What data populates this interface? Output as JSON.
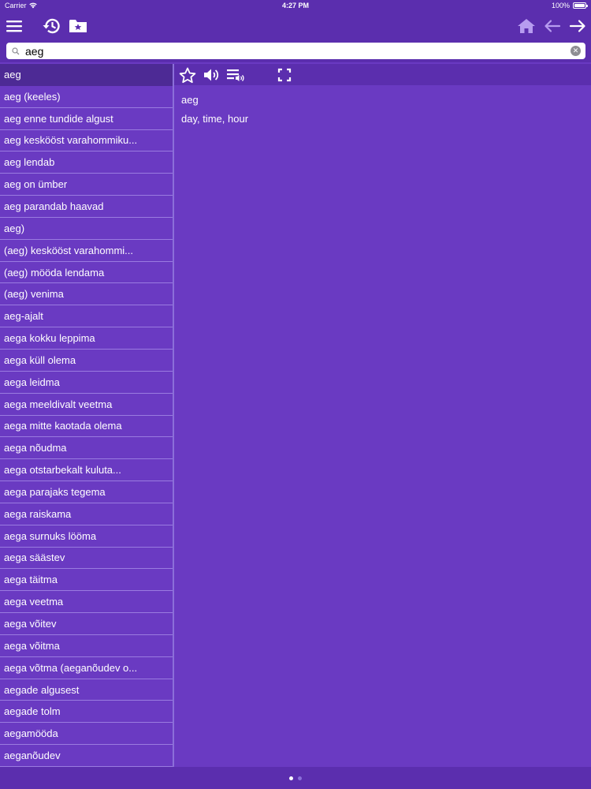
{
  "status": {
    "carrier": "Carrier",
    "time": "4:27 PM",
    "battery": "100%"
  },
  "toolbar": {
    "icons": [
      "menu-icon",
      "history-icon",
      "favorites-folder-icon",
      "home-icon",
      "back-arrow-icon",
      "forward-arrow-icon"
    ]
  },
  "search": {
    "value": "aeg",
    "placeholder": ""
  },
  "word_list": [
    "aeg",
    "aeg (keeles)",
    "aeg enne tundide algust",
    "aeg keskööst varahommiku...",
    "aeg lendab",
    "aeg on ümber",
    "aeg parandab haavad",
    "aeg)",
    "(aeg) keskööst varahommi...",
    "(aeg) mööda lendama",
    "(aeg) venima",
    "aeg-ajalt",
    "aega kokku leppima",
    "aega küll olema",
    "aega leidma",
    "aega meeldivalt veetma",
    "aega mitte kaotada olema",
    "aega nõudma",
    "aega otstarbekalt kuluta...",
    "aega parajaks tegema",
    "aega raiskama",
    "aega surnuks lööma",
    "aega säästev",
    "aega täitma",
    "aega veetma",
    "aega võitev",
    "aega võitma",
    "aega võtma (aeganõudev o...",
    "aegade algusest",
    "aegade tolm",
    "aegamööda",
    "aeganõudev"
  ],
  "selected_index": 0,
  "detail": {
    "word": "aeg",
    "translation": "day, time, hour",
    "tools": [
      "star-icon",
      "speaker-icon",
      "playlist-audio-icon",
      "fullscreen-icon"
    ]
  },
  "pager": {
    "pages": 2,
    "current": 1
  },
  "colors": {
    "background": "#6a3ac2",
    "toolbar": "#5b2eae",
    "selected_row": "#4d2a95",
    "separator": "#9a7be0",
    "inactive_nav": "#b79cf0"
  }
}
